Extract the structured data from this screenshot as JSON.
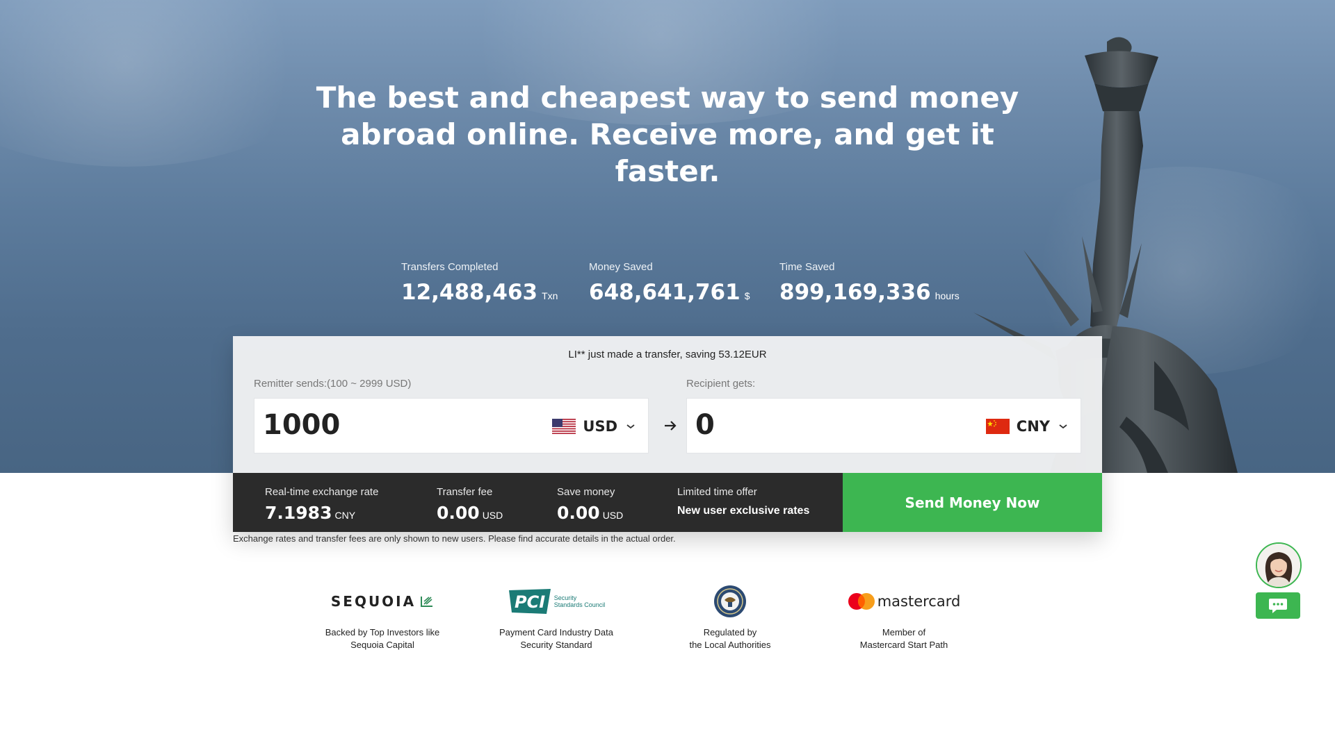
{
  "hero": {
    "headline": [
      "The best and cheapest way to send money",
      "abroad online. Receive more, and get it",
      "faster."
    ],
    "stats": [
      {
        "label": "Transfers Completed",
        "value": "12,488,463",
        "unit": "Txn"
      },
      {
        "label": "Money Saved",
        "value": "648,641,761",
        "unit": "$"
      },
      {
        "label": "Time Saved",
        "value": "899,169,336",
        "unit": "hours"
      }
    ]
  },
  "converter": {
    "ticker": "LI** just made a transfer, saving 53.12EUR",
    "send": {
      "label": "Remitter sends:(100 ~ 2999 USD)",
      "amount": "1000",
      "currency": "USD"
    },
    "receive": {
      "label": "Recipient gets:",
      "amount": "0",
      "currency": "CNY"
    },
    "rate": {
      "label": "Real-time exchange rate",
      "value": "7.1983",
      "unit": "CNY"
    },
    "fee": {
      "label": "Transfer fee",
      "value": "0.00",
      "unit": "USD"
    },
    "save": {
      "label": "Save money",
      "value": "0.00",
      "unit": "USD"
    },
    "offer": {
      "label": "Limited time offer",
      "value": "New user exclusive rates"
    },
    "cta": "Send Money Now",
    "disclaimer": "Exchange rates and transfer fees are only shown to new users. Please find accurate details in the actual order."
  },
  "partners": [
    {
      "logo_text": "SEQUOIA",
      "desc": [
        "Backed by Top Investors like",
        "Sequoia Capital"
      ]
    },
    {
      "logo_text": "PCI",
      "logo_sub": [
        "Security",
        "Standards Council"
      ],
      "desc": [
        "Payment Card Industry Data",
        "Security Standard"
      ]
    },
    {
      "logo_text": "",
      "desc": [
        "Regulated by",
        "the Local Authorities"
      ]
    },
    {
      "logo_text": "mastercard",
      "desc": [
        "Member of",
        "Mastercard Start Path"
      ]
    }
  ],
  "colors": {
    "accent_green": "#3db651",
    "dark_bar": "#2b2b2b",
    "mastercard_red": "#eb001b",
    "mastercard_orange": "#f79e1b",
    "pci_teal": "#1b7b76"
  },
  "icons": {
    "swap": "arrow-right-icon",
    "dropdown": "chevron-down-icon",
    "chat": "chat-bubble-icon"
  }
}
